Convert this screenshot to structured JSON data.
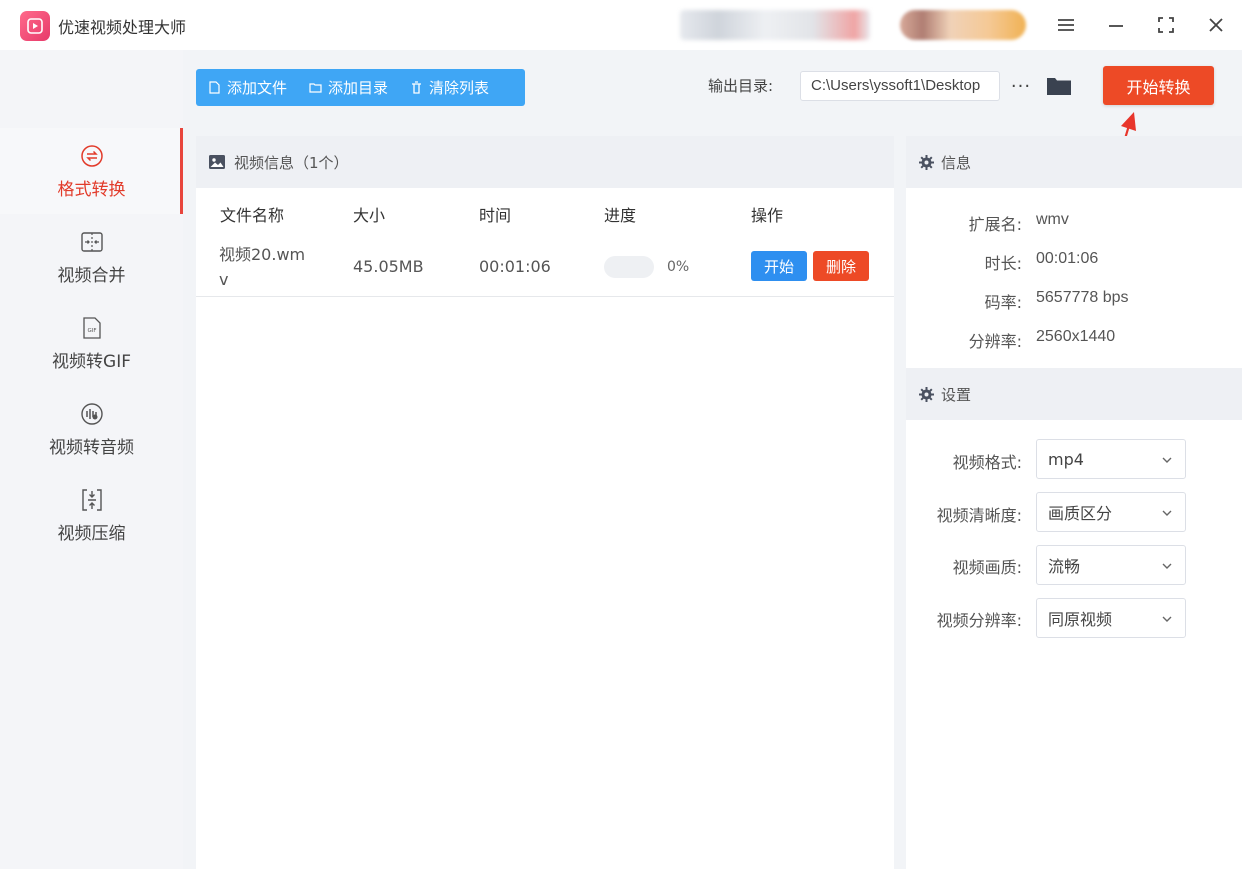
{
  "app": {
    "title": "优速视频处理大师"
  },
  "sidebar": {
    "items": [
      {
        "label": "格式转换",
        "icon": "convert-icon",
        "active": true
      },
      {
        "label": "视频合并",
        "icon": "merge-icon"
      },
      {
        "label": "视频转GIF",
        "icon": "gif-icon"
      },
      {
        "label": "视频转音频",
        "icon": "audio-icon"
      },
      {
        "label": "视频压缩",
        "icon": "compress-icon"
      }
    ]
  },
  "toolbar": {
    "add_file": "添加文件",
    "add_dir": "添加目录",
    "clear_list": "清除列表",
    "output_label": "输出目录:",
    "output_path": "C:\\Users\\yssoft1\\Desktop",
    "more": "···",
    "start_convert": "开始转换"
  },
  "file_panel": {
    "title": "视频信息（1个）",
    "columns": [
      "文件名称",
      "大小",
      "时间",
      "进度",
      "操作"
    ],
    "rows": [
      {
        "name_line1": "视频20.wm",
        "name_line2": "v",
        "size": "45.05MB",
        "time": "00:01:06",
        "progress": "0%",
        "progress_value": 0,
        "start": "开始",
        "delete": "删除"
      }
    ]
  },
  "info_panel": {
    "title": "信息",
    "fields": [
      {
        "label": "扩展名:",
        "value": "wmv"
      },
      {
        "label": "时长:",
        "value": "00:01:06"
      },
      {
        "label": "码率:",
        "value": "5657778 bps"
      },
      {
        "label": "分辨率:",
        "value": "2560x1440"
      }
    ]
  },
  "settings_panel": {
    "title": "设置",
    "fields": [
      {
        "label": "视频格式:",
        "value": "mp4"
      },
      {
        "label": "视频清晰度:",
        "value": "画质区分"
      },
      {
        "label": "视频画质:",
        "value": "流畅"
      },
      {
        "label": "视频分辨率:",
        "value": "同原视频"
      }
    ]
  },
  "colors": {
    "accent_blue": "#3fa6f5",
    "accent_red": "#ed4a26",
    "start_blue": "#2e8ff0",
    "active_nav": "#e23b2a"
  }
}
